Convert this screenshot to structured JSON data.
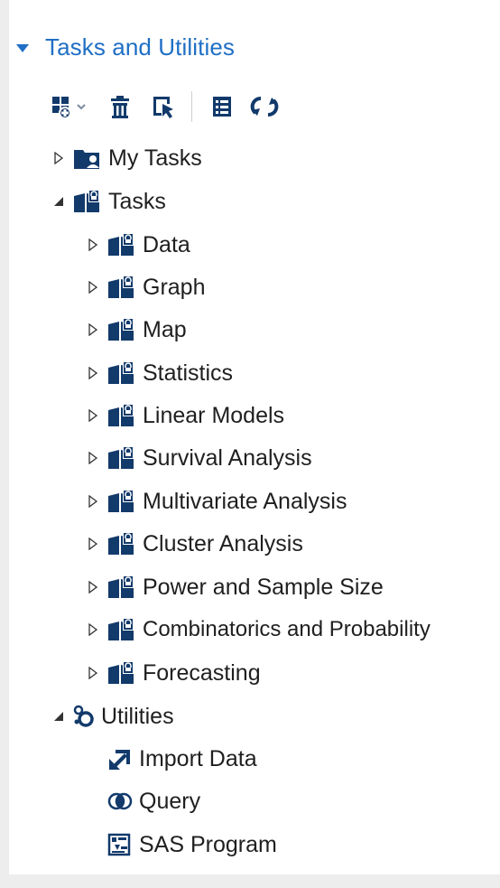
{
  "panel": {
    "title": "Tasks and Utilities"
  },
  "toolbar": {
    "buttons": [
      {
        "icon": "new-task-icon"
      },
      {
        "icon": "delete-icon"
      },
      {
        "icon": "select-icon"
      },
      {
        "icon": "list-view-icon"
      },
      {
        "icon": "refresh-icon"
      }
    ]
  },
  "tree": {
    "my_tasks": "My Tasks",
    "tasks": "Tasks",
    "task_items": [
      "Data",
      "Graph",
      "Map",
      "Statistics",
      "Linear Models",
      "Survival Analysis",
      "Multivariate Analysis",
      "Cluster Analysis",
      "Power and Sample Size",
      "Combinatorics and Probability",
      "Forecasting"
    ],
    "utilities": "Utilities",
    "utility_items": [
      "Import Data",
      "Query",
      "SAS Program"
    ]
  },
  "colors": {
    "accent": "#1f6fc5",
    "icon_dark": "#123a6b"
  }
}
